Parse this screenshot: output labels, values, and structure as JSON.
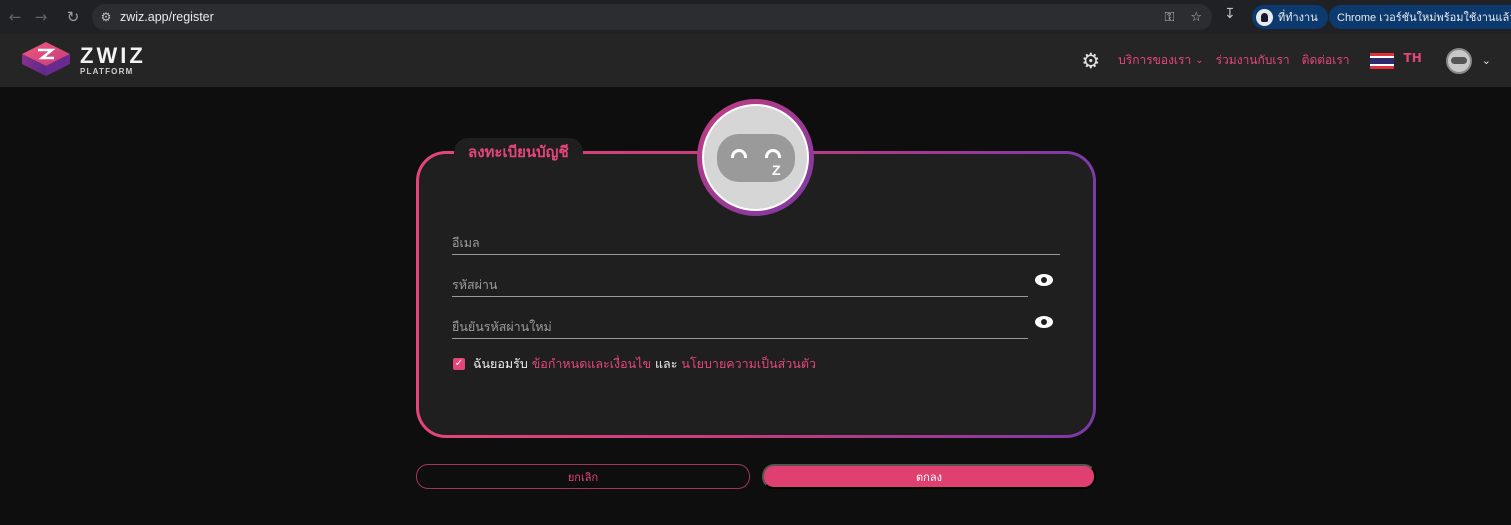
{
  "browser": {
    "url": "zwiz.app/register",
    "profile_label": "ที่ทำงาน",
    "update_label": "Chrome เวอร์ชันใหม่พร้อมใช้งานแล้ว"
  },
  "header": {
    "logo_title": "ZWIZ",
    "logo_subtitle": "PLATFORM",
    "nav_services": "บริการของเรา",
    "nav_partner": "ร่วมงานกับเรา",
    "nav_contact": "ติดต่อเรา",
    "lang": "TH"
  },
  "form": {
    "title": "ลงทะเบียนบัญชี",
    "email_placeholder": "อีเมล",
    "password_placeholder": "รหัสผ่าน",
    "confirm_placeholder": "ยืนยันรหัสผ่านใหม่",
    "agree_prefix": "ฉันยอมรับ",
    "terms_link": "ข้อกำหนดและเงื่อนไข",
    "and_word": "และ",
    "privacy_link": "นโยบายความเป็นส่วนตัว",
    "agree_checked": true,
    "cancel_label": "ยกเลิก",
    "ok_label": "ตกลง"
  },
  "colors": {
    "accent": "#e5467a",
    "gradient_end": "#7b3aa6",
    "card_bg": "#1f1f1f",
    "page_bg": "#0e0e0e"
  },
  "icons": {
    "back": "arrow-left-icon",
    "forward": "arrow-right-icon",
    "reload": "reload-icon",
    "site_settings": "tune-icon",
    "password_manager": "key-icon",
    "bookmark": "star-icon",
    "download": "download-icon",
    "theme": "gear-icon",
    "show_password": "eye-icon",
    "user": "avatar-icon"
  }
}
